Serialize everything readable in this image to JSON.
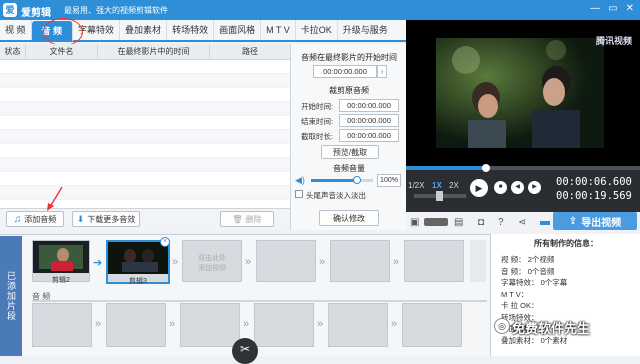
{
  "app": {
    "logo": "爱",
    "name": "爱剪辑",
    "slogan": "最易用、强大的视频剪辑软件"
  },
  "window": {
    "minimize": "—",
    "restore": "▭",
    "close": "✕"
  },
  "tabs": [
    "视  频",
    "音  频",
    "字幕特效",
    "叠加素材",
    "转场特效",
    "画面风格",
    "M T V",
    "卡拉OK",
    "升级与服务"
  ],
  "audio_list": {
    "headers": [
      "状态",
      "文件名",
      "在最终影片中的时间",
      "路径"
    ]
  },
  "buttons": {
    "add_audio": "添加音频",
    "download_more": "下载更多音效",
    "delete": "删除"
  },
  "audio_settings": {
    "start_title": "音频在最终影片的开始时间",
    "start_time": "00:00:00.000",
    "cut_title": "裁剪原音频",
    "start_label": "开始时间:",
    "start_value": "00:00:00.000",
    "end_label": "结束时间:",
    "end_value": "00:00:00.000",
    "length_label": "截取时长:",
    "length_value": "00:00:00.000",
    "preview_cut": "预览/截取",
    "volume_title": "音频音量",
    "volume_value": "100%",
    "fade_label": "头尾声音淡入淡出",
    "confirm": "确认修改"
  },
  "preview": {
    "watermark": "腾讯视频"
  },
  "player": {
    "speed": [
      "1/2X",
      "1X",
      "2X"
    ],
    "time_current": "00:00:06.600",
    "time_total": "00:00:19.569"
  },
  "export": {
    "label": "导出视频"
  },
  "timeline": {
    "side_label": "已添加片段",
    "clips": [
      {
        "name": "剪辑2"
      },
      {
        "name": "剪辑3"
      }
    ],
    "placeholder": "双击此处\n添加视频",
    "audio_label": "音 频"
  },
  "info": {
    "title": "所有制作的信息：",
    "rows": [
      {
        "k": "视    频：",
        "v": "2个视频"
      },
      {
        "k": "音    频：",
        "v": "0个音频"
      },
      {
        "k": "字幕特效：",
        "v": "0个字幕"
      },
      {
        "k": "M T V：",
        "v": ""
      },
      {
        "k": "卡 拉 OK：",
        "v": ""
      },
      {
        "k": "转场特效：",
        "v": ""
      },
      {
        "k": "画面风格：",
        "v": ""
      },
      {
        "k": "叠加素材：",
        "v": "0个素材"
      }
    ]
  },
  "watermark_text": "免费软件先生",
  "colors": {
    "accent": "#2e8ed8",
    "annotation": "#e33333"
  }
}
